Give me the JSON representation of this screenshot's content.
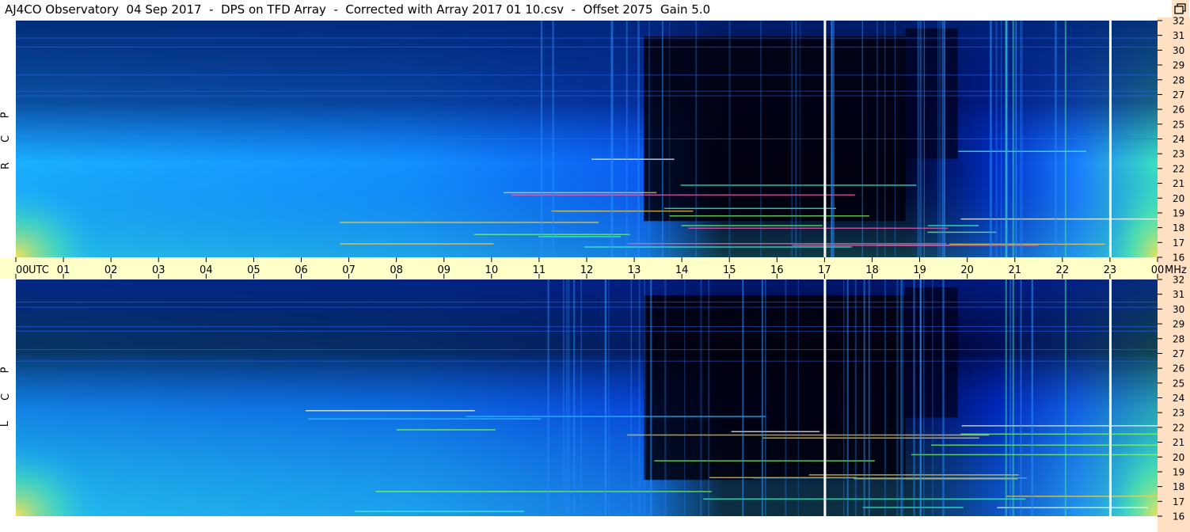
{
  "window": {
    "title": "AJ4CO Observatory  04 Sep 2017  -  DPS on TFD Array  -  Corrected with Array 2017 01 10.csv  -  Offset 2075  Gain 5.0"
  },
  "colors": {
    "background": "#ffffff",
    "time_bar": "#ffffc8",
    "freq_bar": "#ffe0c2",
    "marker_line": "#ffffff"
  },
  "icons": {
    "restore": "restore-window-icon"
  },
  "chart_data": [
    {
      "type": "heatmap",
      "panel": "RCP",
      "polarization_label": [
        "R",
        "C",
        "P"
      ],
      "x_ticks": [
        "00",
        "01",
        "02",
        "03",
        "04",
        "05",
        "06",
        "07",
        "08",
        "09",
        "10",
        "11",
        "12",
        "13",
        "14",
        "15",
        "16",
        "17",
        "18",
        "19",
        "20",
        "21",
        "22",
        "23",
        "00"
      ],
      "x_unit": "UTC",
      "xlim_hours": [
        0,
        24
      ],
      "y_ticks": [
        32,
        31,
        30,
        29,
        28,
        27,
        26,
        25,
        24,
        23,
        22,
        21,
        20,
        19,
        18,
        17,
        16
      ],
      "y_unit": "MHz",
      "ylim_mhz": [
        16,
        32
      ],
      "marker_lines_utc": [
        17.0,
        23.0
      ],
      "colormap": [
        "#000010",
        "#001a7a",
        "#0046ff",
        "#1aa8ff",
        "#30e0d0",
        "#c8f060",
        "#ffd060",
        "#ff60a0"
      ]
    },
    {
      "type": "heatmap",
      "panel": "LCP",
      "polarization_label": [
        "L",
        "C",
        "P"
      ],
      "y_ticks": [
        32,
        31,
        30,
        29,
        28,
        27,
        26,
        25,
        24,
        23,
        22,
        21,
        20,
        19,
        18,
        17,
        16
      ],
      "ylim_mhz": [
        16,
        32
      ],
      "marker_lines_utc": [
        17.0,
        23.0
      ]
    }
  ],
  "x_axis_labels": {
    "utc": "UTC",
    "mhz": "MHz"
  }
}
